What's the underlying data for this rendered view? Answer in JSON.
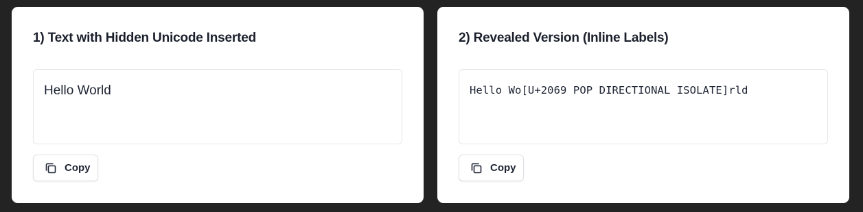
{
  "panels": [
    {
      "title": "1) Text with Hidden Unicode Inserted",
      "text": "Hello World",
      "copy_label": "Copy",
      "copy_icon": "copy-icon"
    },
    {
      "title": "2) Revealed Version (Inline Labels)",
      "text": "Hello Wo[U+2069 POP DIRECTIONAL ISOLATE]rld",
      "copy_label": "Copy",
      "copy_icon": "copy-icon"
    }
  ],
  "colors": {
    "page_background": "#232323",
    "card_background": "#ffffff",
    "text": "#1e2433",
    "border": "#e3e6ea"
  }
}
